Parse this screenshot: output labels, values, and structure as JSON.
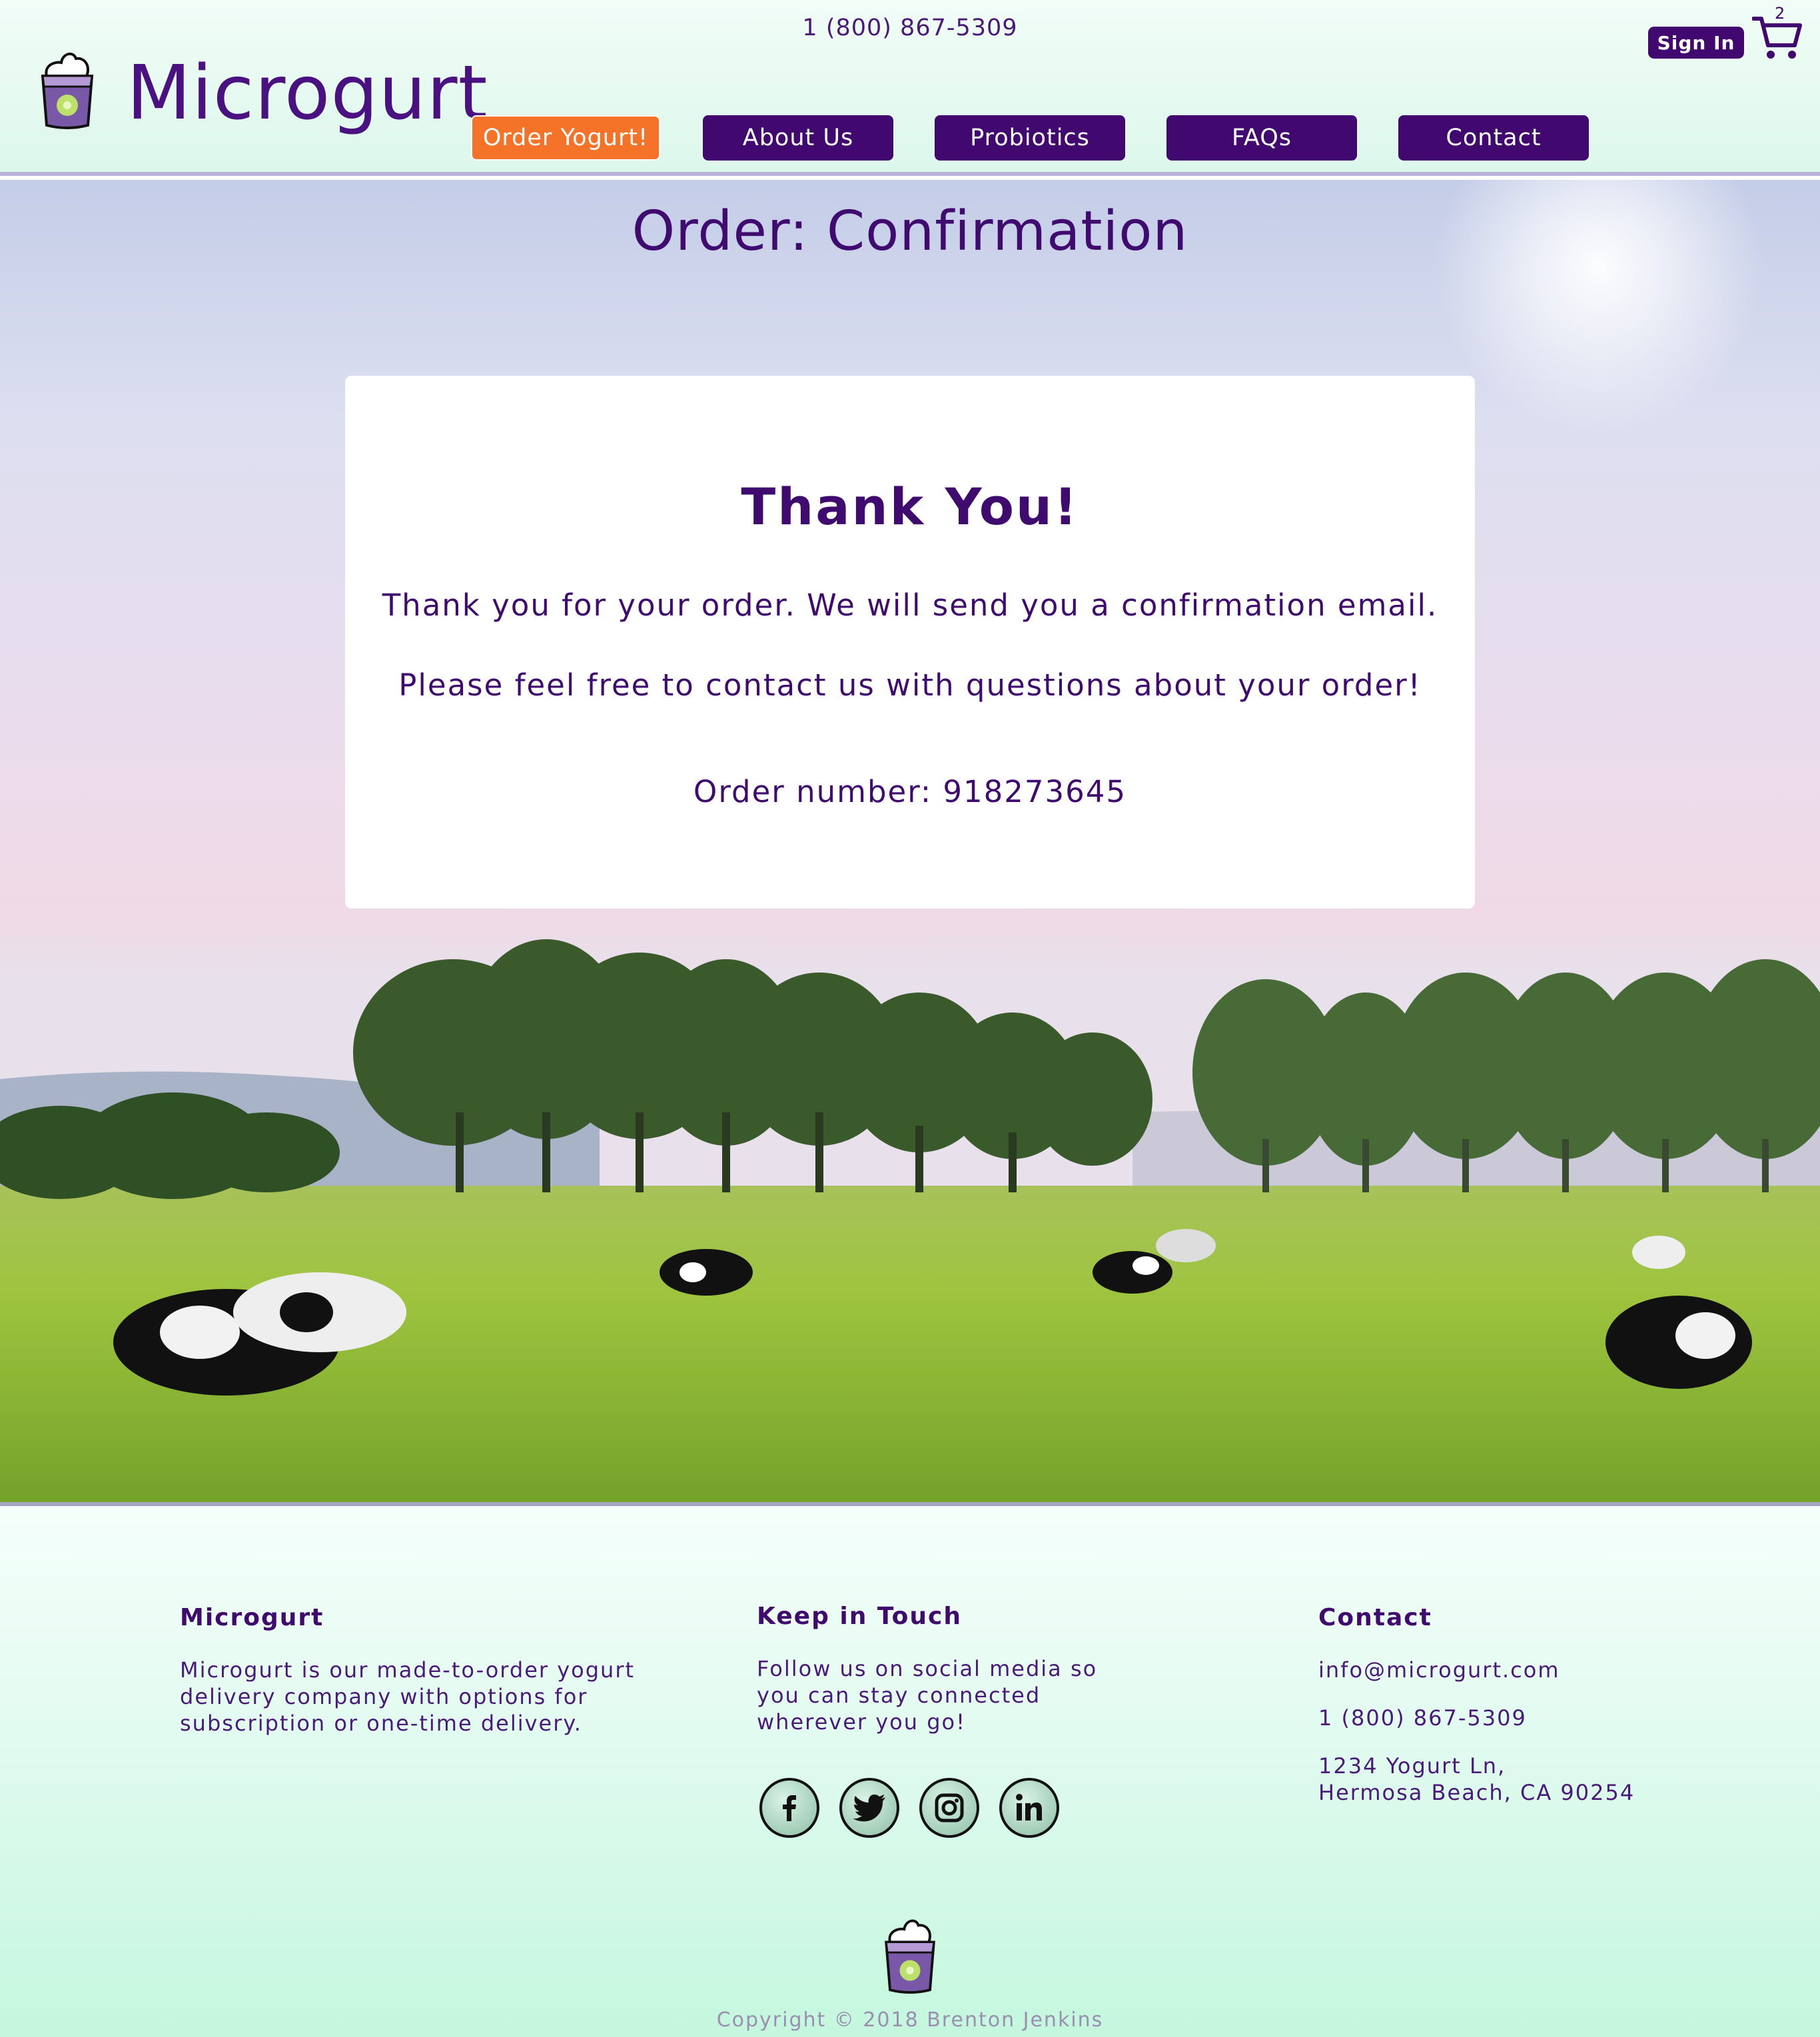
{
  "header": {
    "phone": "1 (800) 867-5309",
    "brand": "Microgurt",
    "sign_in": "Sign In",
    "cart_count": "2",
    "nav": [
      {
        "label": "Order Yogurt!"
      },
      {
        "label": "About Us"
      },
      {
        "label": "Probiotics"
      },
      {
        "label": "FAQs"
      },
      {
        "label": "Contact"
      }
    ]
  },
  "main": {
    "heading": "Order: Confirmation",
    "card": {
      "title": "Thank You!",
      "message1": "Thank you for your order. We will send you a confirmation email.",
      "message2": "Please feel free to contact us with questions about your order!",
      "order_number": "Order number: 918273645"
    }
  },
  "footer": {
    "about": {
      "title": "Microgurt",
      "lines": [
        "Microgurt is our made-to-order yogurt",
        "delivery company with options for",
        "subscription or one-time delivery."
      ]
    },
    "social": {
      "title": "Keep in Touch",
      "lines": [
        "Follow us on social media so",
        "you can stay connected",
        "wherever you go!"
      ],
      "icons": [
        "facebook-icon",
        "twitter-icon",
        "instagram-icon",
        "linkedin-icon"
      ]
    },
    "contact": {
      "title": "Contact",
      "email": "info@microgurt.com",
      "phone": "1 (800) 867-5309",
      "address1": "1234 Yogurt Ln,",
      "address2": "Hermosa Beach, CA 90254"
    },
    "copyright": "Copyright © 2018 Brenton Jenkins"
  },
  "colors": {
    "primary": "#41096f",
    "accent": "#f57328",
    "footer_mint": "#c4f7de"
  }
}
